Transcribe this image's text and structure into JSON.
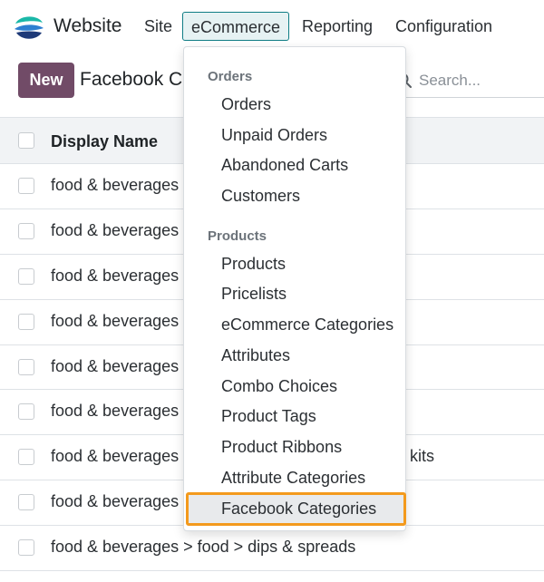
{
  "navbar": {
    "app_name": "Website",
    "menus": [
      "Site",
      "eCommerce",
      "Reporting",
      "Configuration"
    ],
    "active_menu": "eCommerce"
  },
  "control_panel": {
    "new_label": "New",
    "breadcrumb": "Facebook Ca",
    "search_placeholder": "Search..."
  },
  "list": {
    "header": "Display Name",
    "rows": [
      "food & beverages",
      "food & beverages",
      "food & beverages",
      "food & beverages",
      "food & beverages",
      "food & beverages",
      "food & beverages",
      "food & beverages",
      "food & beverages > food > dips & spreads"
    ],
    "row7_trailing": "kits"
  },
  "dropdown": {
    "sections": [
      {
        "title": "Orders",
        "items": [
          "Orders",
          "Unpaid Orders",
          "Abandoned Carts",
          "Customers"
        ]
      },
      {
        "title": "Products",
        "items": [
          "Products",
          "Pricelists",
          "eCommerce Categories",
          "Attributes",
          "Combo Choices",
          "Product Tags",
          "Product Ribbons",
          "Attribute Categories",
          "Facebook Categories"
        ]
      }
    ],
    "highlighted_item": "Facebook Categories"
  },
  "colors": {
    "brand": "#714b67",
    "active_menu_border": "#0f7d85",
    "active_menu_bg": "#e6f2f3",
    "highlight_outline": "#f39a1d"
  }
}
